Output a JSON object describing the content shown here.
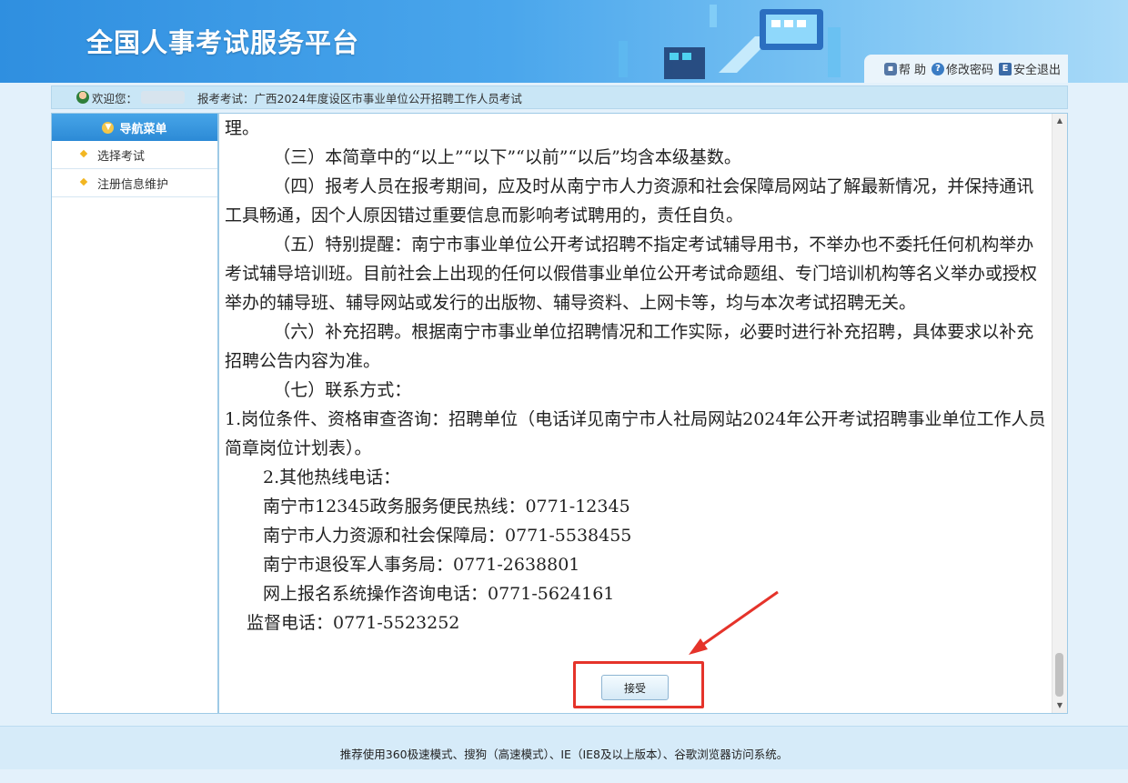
{
  "header": {
    "title": "全国人事考试服务平台",
    "tools": [
      {
        "icon": "lock-icon",
        "label": "帮 助"
      },
      {
        "icon": "help-icon",
        "label": "修改密码"
      },
      {
        "icon": "exit-icon",
        "label": "安全退出"
      }
    ]
  },
  "infobar": {
    "welcome": "欢迎您：",
    "exam_prefix": "报考考试：",
    "exam_name": "广西2024年度设区市事业单位公开招聘工作人员考试"
  },
  "sidebar": {
    "head": "导航菜单",
    "items": [
      "选择考试",
      "注册信息维护"
    ]
  },
  "content": {
    "p0": "理。",
    "p3": "（三）本简章中的“以上”“以下”“以前”“以后”均含本级基数。",
    "p4": "（四）报考人员在报考期间，应及时从南宁市人力资源和社会保障局网站了解最新情况，并保持通讯工具畅通，因个人原因错过重要信息而影响考试聘用的，责任自负。",
    "p5": "（五）特别提醒：南宁市事业单位公开考试招聘不指定考试辅导用书，不举办也不委托任何机构举办考试辅导培训班。目前社会上出现的任何以假借事业单位公开考试命题组、专门培训机构等名义举办或授权举办的辅导班、辅导网站或发行的出版物、辅导资料、上网卡等，均与本次考试招聘无关。",
    "p6": "（六）补充招聘。根据南宁市事业单位招聘情况和工作实际，必要时进行补充招聘，具体要求以补充招聘公告内容为准。",
    "p7": "（七）联系方式：",
    "c1": "1.岗位条件、资格审查咨询：招聘单位（电话详见南宁市人社局网站2024年公开考试招聘事业单位工作人员简章岗位计划表）。",
    "c2": "2.其他热线电话：",
    "h1": "南宁市12345政务服务便民热线：0771-12345",
    "h2": "南宁市人力资源和社会保障局：0771-5538455",
    "h3": "南宁市退役军人事务局：0771-2638801",
    "h4": "网上报名系统操作咨询电话：0771-5624161",
    "h5": "监督电话：0771-5523252",
    "accept": "接受"
  },
  "footer": {
    "text": "推荐使用360极速模式、搜狗（高速模式）、IE（IE8及以上版本）、谷歌浏览器访问系统。"
  },
  "colors": {
    "header_blue": "#2f8fe0",
    "annotation_red": "#e5332a"
  }
}
